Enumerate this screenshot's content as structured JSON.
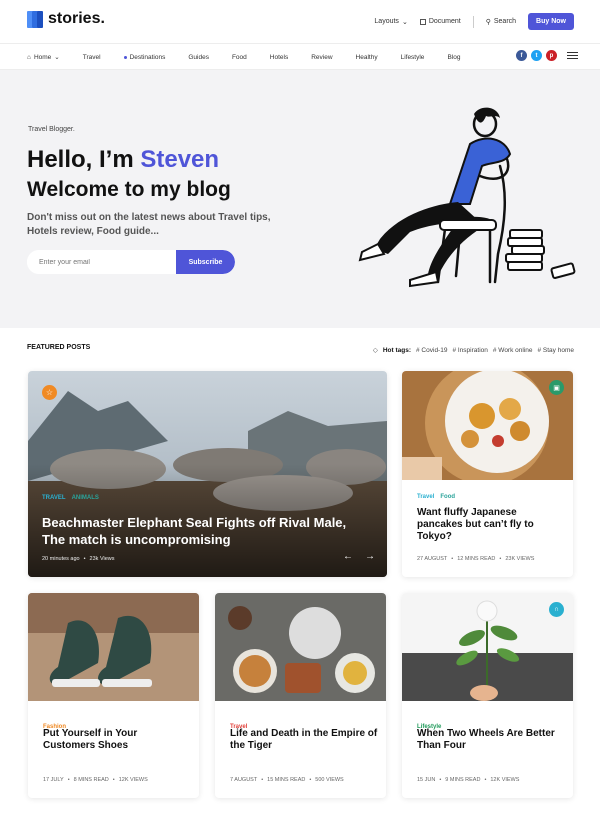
{
  "brand": {
    "name": "stories."
  },
  "header": {
    "layouts": "Layouts",
    "document": "Document",
    "search": "Search",
    "buy": "Buy Now"
  },
  "nav": {
    "items": [
      {
        "label": "Home"
      },
      {
        "label": "Travel"
      },
      {
        "label": "Destinations"
      },
      {
        "label": "Guides"
      },
      {
        "label": "Food"
      },
      {
        "label": "Hotels"
      },
      {
        "label": "Review"
      },
      {
        "label": "Healthy"
      },
      {
        "label": "Lifestyle"
      },
      {
        "label": "Blog"
      }
    ],
    "socials": [
      "f",
      "t",
      "p"
    ]
  },
  "hero": {
    "tag": "Travel Blogger.",
    "greeting": "Hello, I’m ",
    "name": "Steven",
    "welcome": "Welcome to my blog",
    "description": "Don't miss out on the latest news about Travel tips, Hotels review, Food guide...",
    "email_placeholder": "Enter your email",
    "subscribe": "Subscribe"
  },
  "featured": {
    "title": "FEATURED POSTS",
    "hot_tags_label": "Hot tags:",
    "hot_tags": [
      "# Covid-19",
      "# Inspiration",
      "# Work online",
      "# Stay home"
    ]
  },
  "posts": [
    {
      "cats": [
        "TRAVEL",
        "ANIMALS"
      ],
      "title": "Beachmaster Elephant Seal Fights off Rival Male, The match is uncompromising",
      "time": "20 minutes ago",
      "views": "23k Views"
    },
    {
      "cats": [
        "Travel",
        "Food"
      ],
      "title": "Want fluffy Japanese pancakes but can’t fly to Tokyo?",
      "date": "27 AUGUST",
      "read": "12 MINS READ",
      "views": "23K VIEWS"
    },
    {
      "cats": [
        "Fashion"
      ],
      "title": "Put Yourself in Your Customers Shoes",
      "date": "17 JULY",
      "read": "8 MINS READ",
      "views": "12K VIEWS"
    },
    {
      "cats": [
        "Travel"
      ],
      "title": "Life and Death in the Empire of the Tiger",
      "date": "7 AUGUST",
      "read": "15 MINS READ",
      "views": "500 VIEWS"
    },
    {
      "cats": [
        "Lifestyle"
      ],
      "title": "When Two Wheels Are Better Than Four",
      "date": "15 JUN",
      "read": "9 MINS READ",
      "views": "12K VIEWS"
    }
  ],
  "colors": {
    "accent": "#4f55d8",
    "travel": "#2aa39a",
    "food": "#2aa39a",
    "fashion": "#f08a24",
    "travel_red": "#e0403a",
    "lifestyle": "#1f9a5a"
  }
}
